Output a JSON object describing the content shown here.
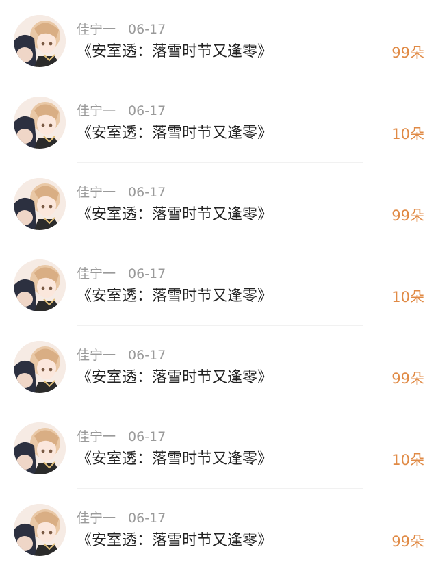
{
  "accent_color": "#e08a45",
  "items": [
    {
      "user": "佳宁一",
      "date": "06-17",
      "title": "《安室透：落雪时节又逢零》",
      "gift": "99朵",
      "avatar_icon": "avatar-anime-icon"
    },
    {
      "user": "佳宁一",
      "date": "06-17",
      "title": "《安室透：落雪时节又逢零》",
      "gift": "10朵",
      "avatar_icon": "avatar-anime-icon"
    },
    {
      "user": "佳宁一",
      "date": "06-17",
      "title": "《安室透：落雪时节又逢零》",
      "gift": "99朵",
      "avatar_icon": "avatar-anime-icon"
    },
    {
      "user": "佳宁一",
      "date": "06-17",
      "title": "《安室透：落雪时节又逢零》",
      "gift": "10朵",
      "avatar_icon": "avatar-anime-icon"
    },
    {
      "user": "佳宁一",
      "date": "06-17",
      "title": "《安室透：落雪时节又逢零》",
      "gift": "99朵",
      "avatar_icon": "avatar-anime-icon"
    },
    {
      "user": "佳宁一",
      "date": "06-17",
      "title": "《安室透：落雪时节又逢零》",
      "gift": "10朵",
      "avatar_icon": "avatar-anime-icon"
    },
    {
      "user": "佳宁一",
      "date": "06-17",
      "title": "《安室透：落雪时节又逢零》",
      "gift": "99朵",
      "avatar_icon": "avatar-anime-icon"
    }
  ]
}
